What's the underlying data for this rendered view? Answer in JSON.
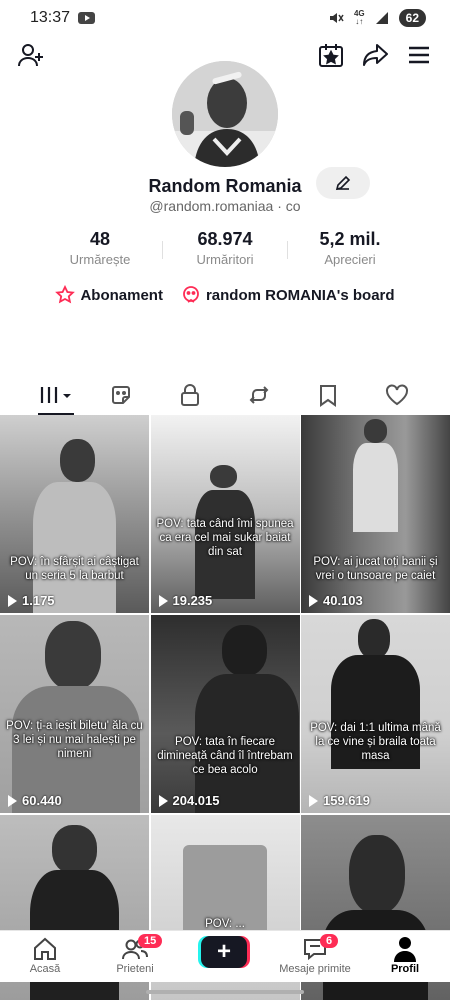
{
  "status": {
    "time": "13:37",
    "network": "4G",
    "battery": "62"
  },
  "profile": {
    "name": "Random Romania",
    "handle": "@random.romaniaa · co",
    "stats": [
      {
        "value": "48",
        "label": "Urmărește"
      },
      {
        "value": "68.974",
        "label": "Urmăritori"
      },
      {
        "value": "5,2 mil.",
        "label": "Aprecieri"
      }
    ],
    "subscription_label": "Abonament",
    "board_label": "random ROMANIA's board"
  },
  "tabs": [
    "videos-icon",
    "reposts-sticker-icon",
    "lock-icon",
    "repost-icon",
    "bookmark-icon",
    "heart-icon"
  ],
  "videos": [
    {
      "caption": "POV: în sfârșit ai câștigat un seria 5 la barbut",
      "views": "1.175",
      "tone": "#9a9a9a"
    },
    {
      "caption": "POV: tata când îmi spunea ca era cel mai sukar baiat din sat",
      "views": "19.235",
      "tone": "#8c8c8c"
    },
    {
      "caption": "POV: ai jucat toți banii și vrei o tunsoare pe caiet",
      "views": "40.103",
      "tone": "#6a6a6a"
    },
    {
      "caption": "POV: ți-a ieșit biletu' ăla cu 3 lei și nu mai halești pe nimeni",
      "views": "60.440",
      "tone": "#9e9e9e"
    },
    {
      "caption": "POV: tata în fiecare dimineață când îl întrebam ce bea acolo",
      "views": "204.015",
      "tone": "#5e5e5e"
    },
    {
      "caption": "POV: dai 1:1 ultima mână la ce vine și braila toata masa",
      "views": "159.619",
      "tone": "#b5b5b5"
    },
    {
      "caption": "",
      "views": "",
      "tone": "#a8a8a8"
    },
    {
      "caption": "POV: ...",
      "views": "",
      "tone": "#c8c8c8"
    },
    {
      "caption": "",
      "views": "",
      "tone": "#7a7a7a"
    }
  ],
  "nav": {
    "home": "Acasă",
    "friends": "Prieteni",
    "friends_badge": "15",
    "inbox": "Mesaje primite",
    "inbox_badge": "6",
    "profile": "Profil"
  }
}
